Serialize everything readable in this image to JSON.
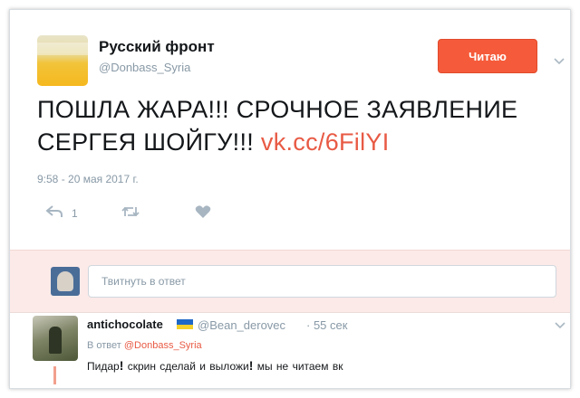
{
  "tweet": {
    "display_name": "Русский фронт",
    "handle": "@Donbass_Syria",
    "follow_label": "Читаю",
    "text_main": "ПОШЛА ЖАРА!!! СРОЧНОЕ ЗАЯВЛЕНИЕ СЕРГЕЯ ШОЙГУ!!! ",
    "text_link": "vk.cc/6FilYI",
    "timestamp": "9:58 - 20 мая 2017 г.",
    "reply_count": "1",
    "icons": {
      "reply": "reply-icon",
      "retweet": "retweet-icon",
      "like": "heart-icon",
      "more": "chevron-down-icon"
    }
  },
  "reply_box": {
    "placeholder": "Твитнуть в ответ"
  },
  "reply": {
    "display_name": "antichocolate",
    "handle": "@Bean_derovec",
    "time": "· 55 сек",
    "in_reply_prefix": "В ответ ",
    "in_reply_handle": "@Donbass_Syria",
    "text_part1": "Пидар",
    "bang1": "!",
    "text_part2": " скрин сделай и выложи",
    "bang2": "!",
    "text_part3": " мы не читаем вк"
  },
  "colors": {
    "accent": "#f55b3a",
    "link": "#e85a44",
    "muted": "#8899a6",
    "reply_region_bg": "#fbeae8"
  }
}
